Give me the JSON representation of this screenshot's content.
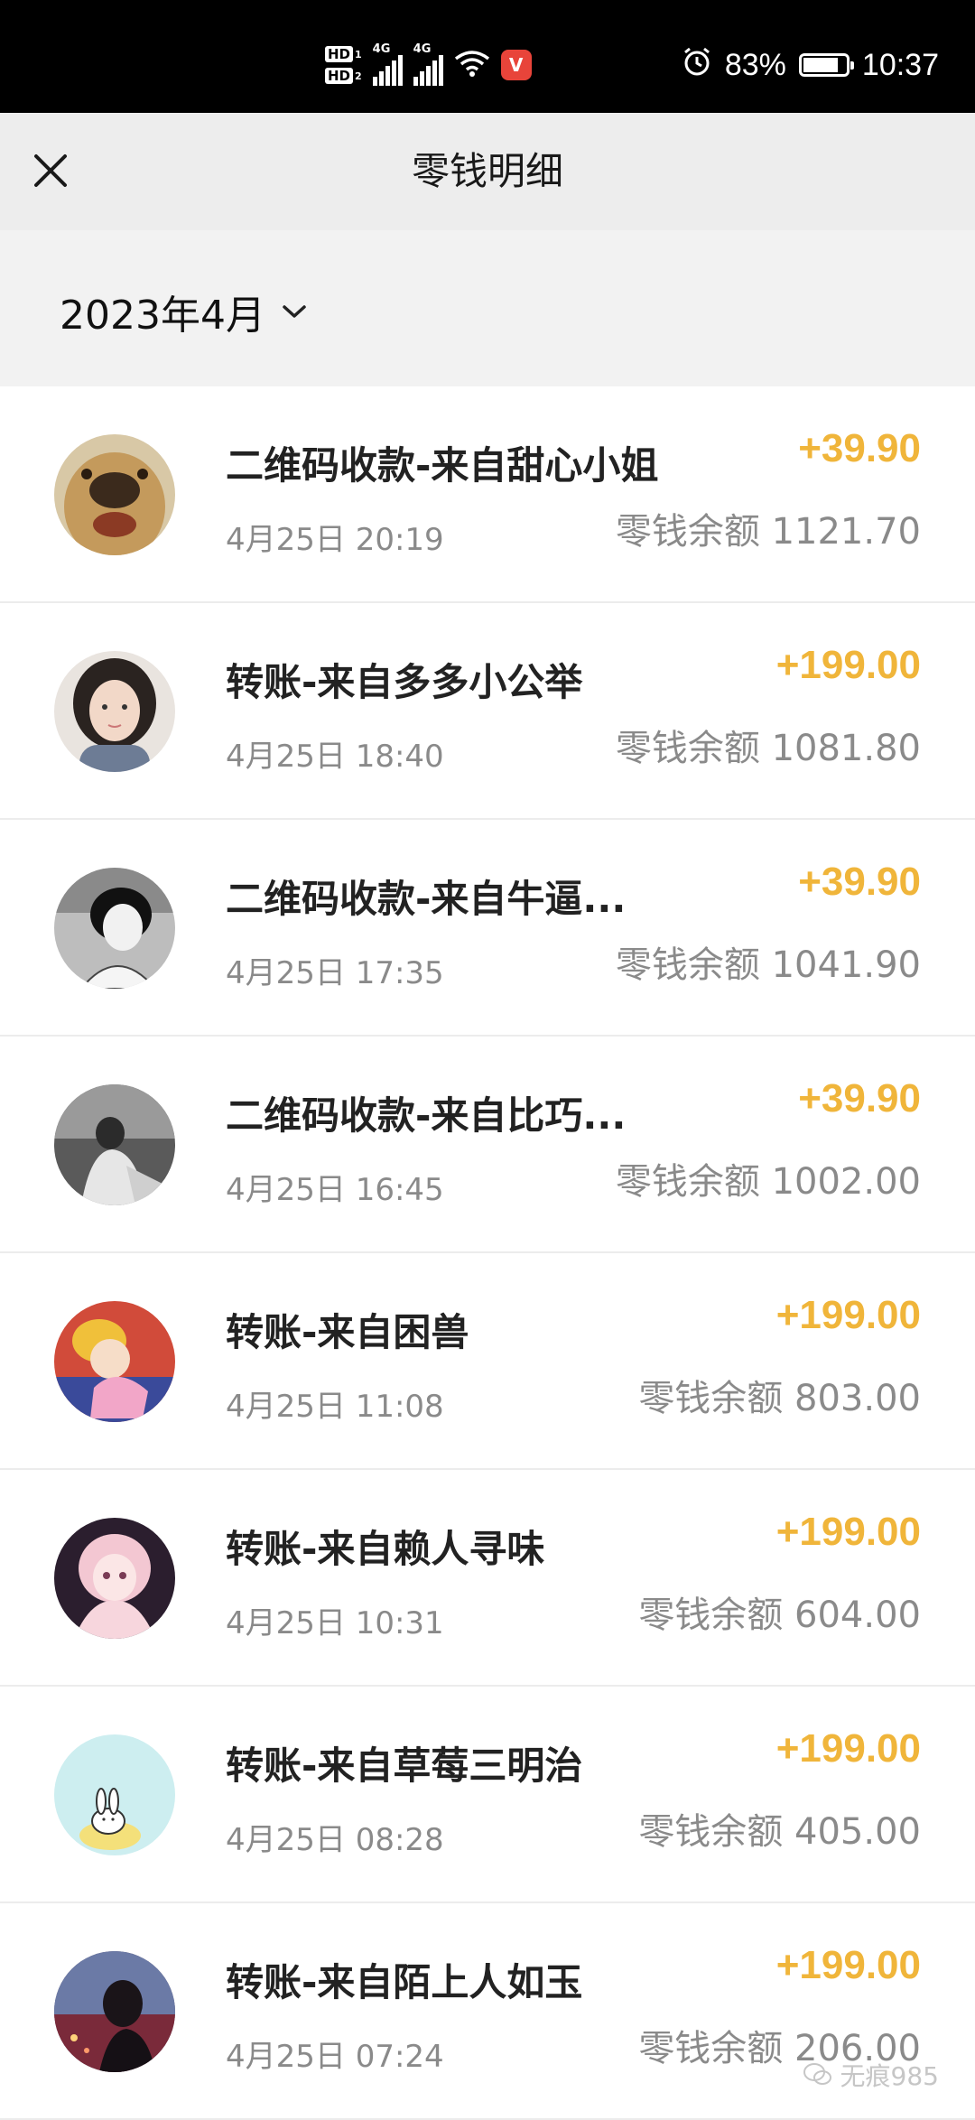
{
  "status_bar": {
    "hd1": "HD",
    "hd1_num": "1",
    "hd2": "HD",
    "hd2_num": "2",
    "net1": "4G",
    "net2": "4G",
    "vivo_label": "V",
    "battery_percent": "83%",
    "battery_level": 0.83,
    "time": "10:37",
    "icons": [
      "signal-icon",
      "wifi-icon",
      "alarm-icon",
      "battery-icon"
    ]
  },
  "header": {
    "title": "零钱明细",
    "close_icon": "close-icon"
  },
  "filter": {
    "month": "2023年4月",
    "dropdown_icon": "chevron-down-icon"
  },
  "colors": {
    "amount": "#f0b53a",
    "muted": "#8a8a8a",
    "title_bar_bg": "#ededed",
    "status_bar_bg": "#000000"
  },
  "transactions": [
    {
      "title": "二维码收款-来自甜心小姐",
      "time": "4月25日 20:19",
      "amount": "+39.90",
      "balance": "零钱余额 1121.70",
      "avatar": "dog-avatar"
    },
    {
      "title": "转账-来自多多小公举",
      "time": "4月25日 18:40",
      "amount": "+199.00",
      "balance": "零钱余额 1081.80",
      "avatar": "girl-avatar"
    },
    {
      "title": "二维码收款-来自牛逼...",
      "time": "4月25日 17:35",
      "amount": "+39.90",
      "balance": "零钱余额 1041.90",
      "avatar": "anime-boy-avatar"
    },
    {
      "title": "二维码收款-来自比巧...",
      "time": "4月25日 16:45",
      "amount": "+39.90",
      "balance": "零钱余额 1002.00",
      "avatar": "bw-photo-avatar"
    },
    {
      "title": "转账-来自困兽",
      "time": "4月25日 11:08",
      "amount": "+199.00",
      "balance": "零钱余额 803.00",
      "avatar": "sailor-moon-avatar"
    },
    {
      "title": "转账-来自赖人寻味",
      "time": "4月25日 10:31",
      "amount": "+199.00",
      "balance": "零钱余额 604.00",
      "avatar": "anime-girl-avatar"
    },
    {
      "title": "转账-来自草莓三明治",
      "time": "4月25日 08:28",
      "amount": "+199.00",
      "balance": "零钱余额 405.00",
      "avatar": "bunny-avatar"
    },
    {
      "title": "转账-来自陌上人如玉",
      "time": "4月25日 07:24",
      "amount": "+199.00",
      "balance": "零钱余额 206.00",
      "avatar": "night-city-avatar"
    }
  ],
  "watermark": {
    "text": "无痕985",
    "icon": "wechat-official-icon"
  }
}
